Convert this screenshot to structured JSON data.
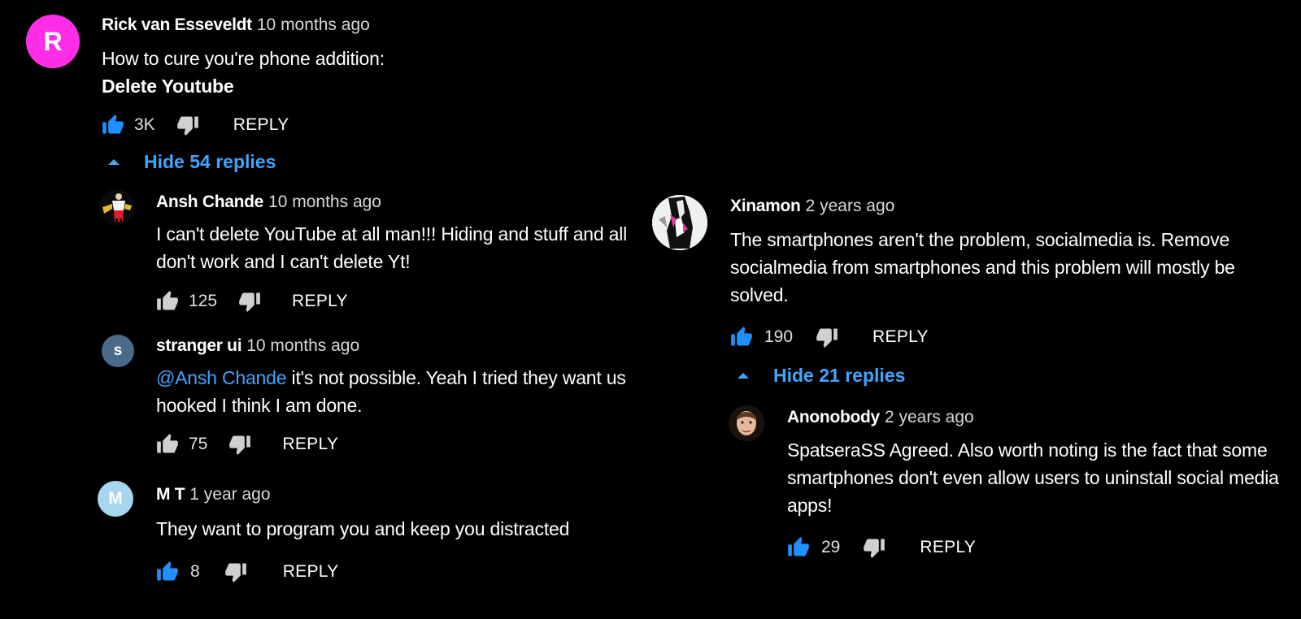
{
  "left_thread": {
    "comment": {
      "avatar_letter": "R",
      "avatar_color": "#ff2ee6",
      "author": "Rick van Esseveldt",
      "time": "10 months ago",
      "line1": "How to cure you're phone addition:",
      "line2": "Delete Youtube",
      "likes": "3K",
      "reply_label": "REPLY",
      "like_active": true
    },
    "toggle_label": "Hide 54 replies",
    "replies": [
      {
        "avatar_icon": "user-photo-avatar",
        "author": "Ansh Chande",
        "time": "10 months ago",
        "text": "I can't delete YouTube at all man!!! Hiding and stuff and all don't work and I can't delete Yt!",
        "likes": "125",
        "reply_label": "REPLY",
        "like_active": false
      },
      {
        "avatar_letter": "s",
        "avatar_color": "#4a6a8a",
        "author": "stranger ui",
        "time": "10 months ago",
        "mention": "@Ansh Chande",
        "text": " it's not possible. Yeah I tried they want us hooked I think I am done.",
        "likes": "75",
        "reply_label": "REPLY",
        "like_active": false
      },
      {
        "avatar_letter": "M",
        "avatar_color": "#a7d7f0",
        "author": "M T",
        "time": "1 year ago",
        "text": "They want to program you and keep you distracted",
        "likes": "8",
        "reply_label": "REPLY",
        "like_active": true
      }
    ]
  },
  "right_thread": {
    "comment": {
      "avatar_icon": "user-photo-avatar",
      "author": "Xinamon",
      "time": "2 years ago",
      "text": "The smartphones aren't the problem, socialmedia is. Remove socialmedia from smartphones and this problem will mostly be solved.",
      "likes": "190",
      "reply_label": "REPLY",
      "like_active": true
    },
    "toggle_label": "Hide 21 replies",
    "replies": [
      {
        "avatar_icon": "user-photo-avatar",
        "author": "Anonobody",
        "time": "2 years ago",
        "text": "SpatseraSS Agreed. Also worth noting is the fact that some smartphones don't even allow users to uninstall social media apps!",
        "likes": "29",
        "reply_label": "REPLY",
        "like_active": true
      }
    ]
  },
  "colors": {
    "link_blue": "#3ea6ff",
    "like_active_blue": "#1e90ff",
    "background": "#000000"
  }
}
